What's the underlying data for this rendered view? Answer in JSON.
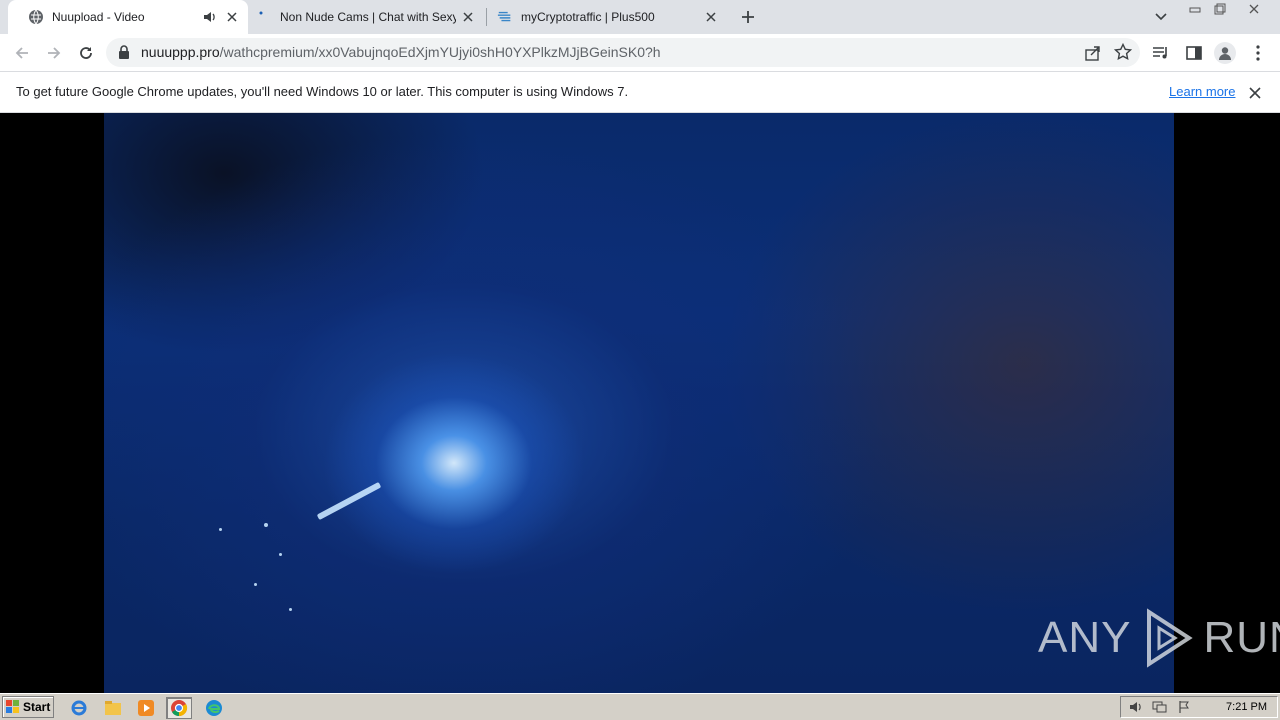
{
  "browser": {
    "tabs": [
      {
        "title": "Nuupload - Video",
        "active": true,
        "audio": true
      },
      {
        "title": "Non Nude Cams | Chat with Sexy No",
        "active": false
      },
      {
        "title": "myCryptotraffic | Plus500",
        "active": false
      }
    ],
    "omnibox": {
      "host": "nuuuppp.pro",
      "path": "/wathcpremium/xx0VabujnqoEdXjmYUjyi0shH0YXPlkzMJjBGeinSK0?h"
    }
  },
  "infobar": {
    "message": "To get future Google Chrome updates, you'll need Windows 10 or later. This computer is using Windows 7.",
    "learn_more": "Learn more"
  },
  "watermark": {
    "left": "ANY",
    "right": "RUN"
  },
  "taskbar": {
    "start_label": "Start",
    "clock": "7:21 PM"
  },
  "colors": {
    "accent_link": "#1a73e8",
    "tabstrip": "#dee1e6",
    "taskbar": "#d4d0c8"
  }
}
